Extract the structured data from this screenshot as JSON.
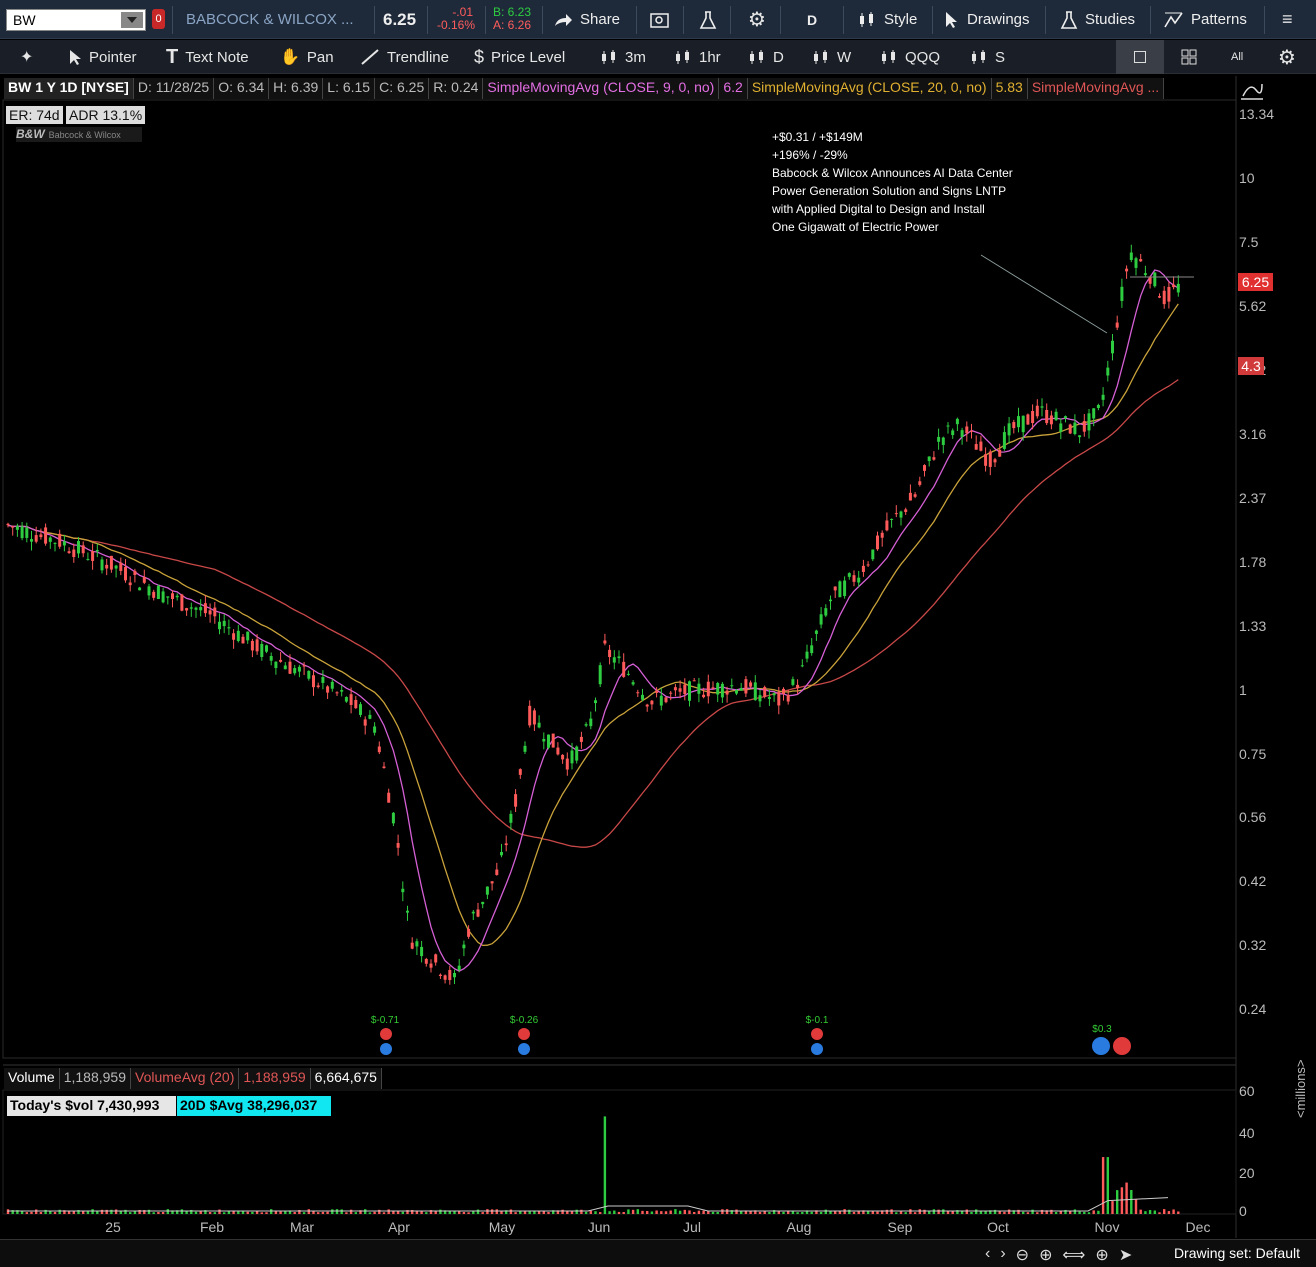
{
  "topbar": {
    "symbol": "BW",
    "link_badge": "0",
    "company": "BABCOCK & WILCOX ...",
    "last": "6.25",
    "change": "-.01",
    "change_pct": "-0.16%",
    "bid": "B: 6.23",
    "ask": "A: 6.26",
    "share": "Share",
    "period": "D",
    "style": "Style",
    "drawings": "Drawings",
    "studies": "Studies",
    "patterns": "Patterns"
  },
  "toolbar2": {
    "pointer": "Pointer",
    "text_note": "Text Note",
    "pan": "Pan",
    "trendline": "Trendline",
    "price_level": "Price Level",
    "agg_3m": "3m",
    "agg_1hr": "1hr",
    "agg_d": "D",
    "agg_w": "W",
    "qqq": "QQQ",
    "s": "S"
  },
  "header": {
    "title": "BW 1 Y 1D [NYSE]",
    "date": "D: 11/28/25",
    "open": "O: 6.34",
    "high": "H: 6.39",
    "low": "L: 6.15",
    "close": "C: 6.25",
    "range": "R: 0.24",
    "sma9_label": "SimpleMovingAvg (CLOSE, 9, 0, no)",
    "sma9_value": "6.2",
    "sma20_label": "SimpleMovingAvg (CLOSE, 20, 0, no)",
    "sma20_value": "5.83",
    "sma50_label": "SimpleMovingAvg ..."
  },
  "badges": {
    "er": "ER: 74d",
    "adr": "ADR 13.1%",
    "logo_mark": "B&W",
    "logo_text": "Babcock & Wilcox"
  },
  "annotation": {
    "line1": "+$0.31 / +$149M",
    "line2": "+196% / -29%",
    "line3": "Babcock & Wilcox Announces AI Data Center",
    "line4": "Power Generation Solution and Signs LNTP",
    "line5": "with Applied Digital to Design and Install",
    "line6": "One Gigawatt of Electric Power"
  },
  "price_tags": {
    "last": "6.25",
    "sma50": "4.3"
  },
  "earnings": [
    {
      "label": "$-0.71"
    },
    {
      "label": "$-0.26"
    },
    {
      "label": "$-0.1"
    },
    {
      "label": "$0.3"
    }
  ],
  "chart_data": {
    "type": "candlestick",
    "symbol": "BW",
    "y_scale": "log",
    "y_ticks": [
      "13.34",
      "10",
      "7.5",
      "5.62",
      "4.22",
      "3.16",
      "2.37",
      "1.78",
      "1.33",
      "1",
      "0.75",
      "0.56",
      "0.42",
      "0.32",
      "0.24"
    ],
    "x_ticks": [
      "25",
      "Feb",
      "Mar",
      "Apr",
      "May",
      "Jun",
      "Jul",
      "Aug",
      "Sep",
      "Oct",
      "Nov",
      "Dec"
    ],
    "series": [
      {
        "name": "SimpleMovingAvg (CLOSE, 9, 0, no)",
        "color": "#d55fd5"
      },
      {
        "name": "SimpleMovingAvg (CLOSE, 20, 0, no)",
        "color": "#c9a23a"
      },
      {
        "name": "SimpleMovingAvg",
        "color": "#c84848"
      }
    ],
    "close_path": [
      [
        "25",
        2.1
      ],
      [
        "Feb",
        1.6
      ],
      [
        "Mar",
        1.1
      ],
      [
        "Apr",
        0.6
      ],
      [
        "Apr",
        0.28
      ],
      [
        "May",
        0.75
      ],
      [
        "Jun",
        1.33
      ],
      [
        "Jul",
        1.0
      ],
      [
        "Aug",
        1.1
      ],
      [
        "Sep",
        2.37
      ],
      [
        "Oct",
        3.5
      ],
      [
        "Nov",
        6.5
      ],
      [
        "Dec",
        6.25
      ]
    ]
  },
  "volume": {
    "title": "Volume",
    "value": "1,188,959",
    "avg_label": "VolumeAvg (20)",
    "avg_value": "1,188,959",
    "avg2": "6,664,675",
    "todays_dvol": "Today's $vol 7,430,993",
    "avg_dvol": "20D $Avg 38,296,037",
    "y_ticks": [
      "60",
      "40",
      "20",
      "0"
    ],
    "unit": "<millions>"
  },
  "bottom": {
    "drawing_set": "Drawing set: Default"
  },
  "colors": {
    "up": "#2ecc40",
    "down": "#ff5a5a",
    "bg": "#000000",
    "toolbar": "#1e2a3a"
  }
}
